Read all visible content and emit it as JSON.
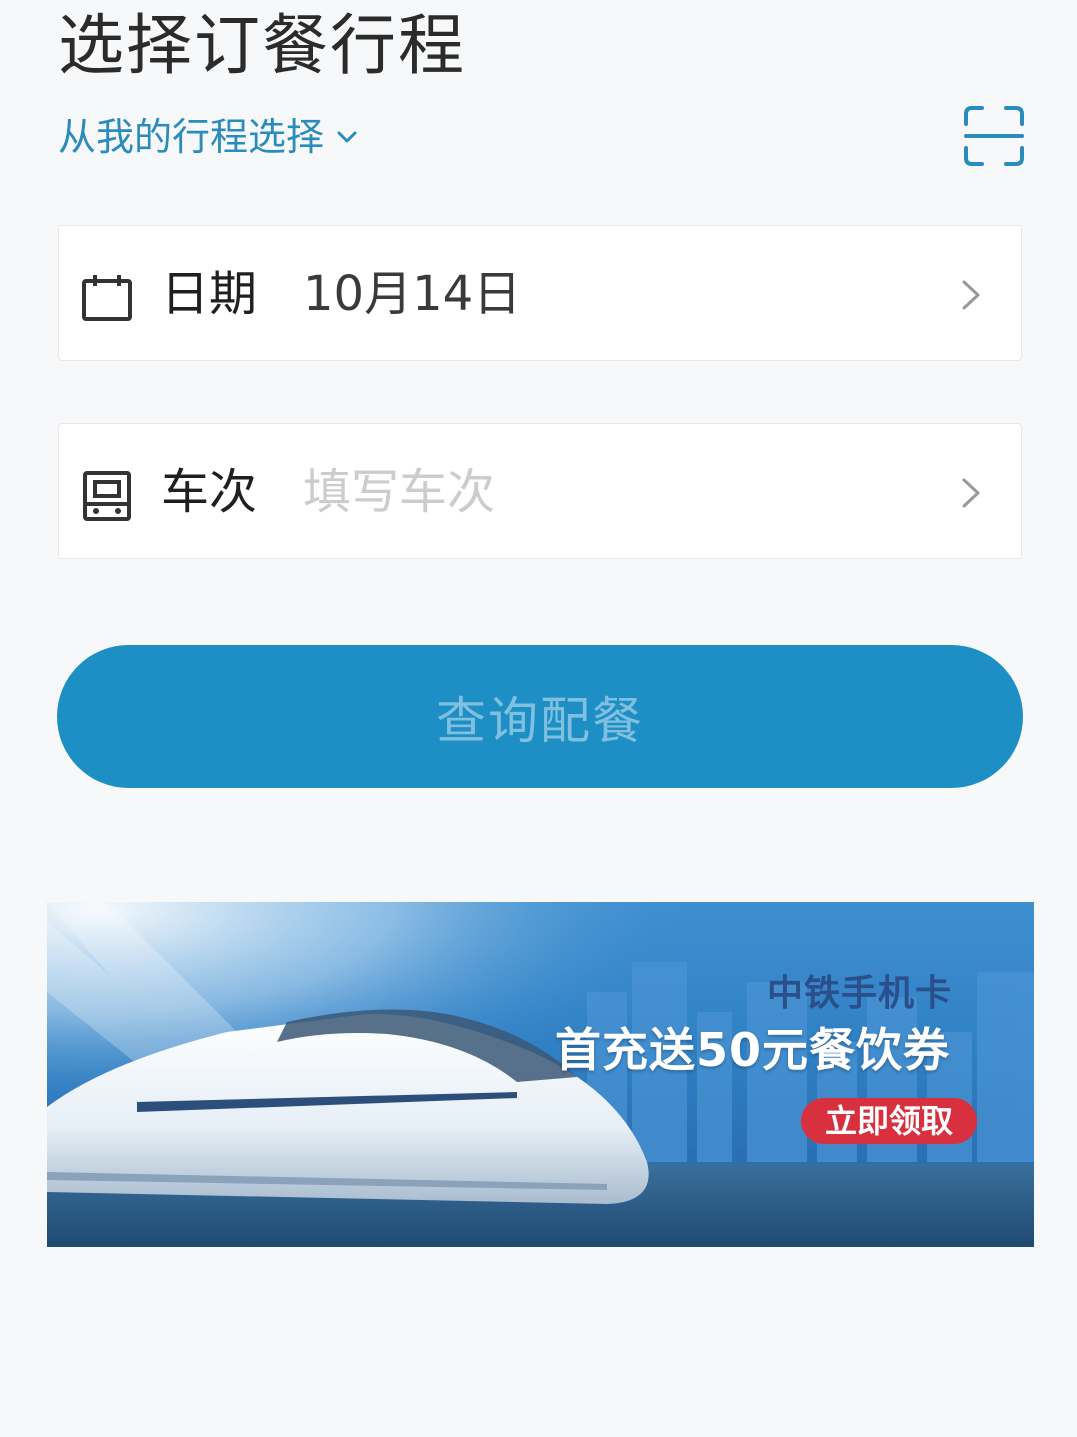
{
  "header": {
    "title": "选择订餐行程",
    "trip_select_label": "从我的行程选择",
    "scan_icon": "scan-icon"
  },
  "form": {
    "date": {
      "label": "日期",
      "value": "10月14日",
      "icon": "calendar-icon"
    },
    "train": {
      "label": "车次",
      "placeholder": "填写车次",
      "icon": "train-icon"
    }
  },
  "actions": {
    "query_label": "查询配餐"
  },
  "banner": {
    "brand": "中铁手机卡",
    "promo": "首充送50元餐饮券",
    "cta": "立即领取"
  },
  "colors": {
    "accent": "#1e8fc4",
    "link": "#2a8bbd",
    "cta_red": "#d8303e",
    "background": "#f7f8fa"
  }
}
